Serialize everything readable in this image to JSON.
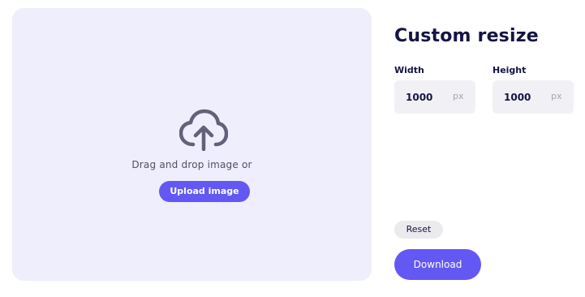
{
  "dropzone": {
    "icon": "cloud-upload-icon",
    "text": "Drag and drop image or",
    "upload_label": "Upload image"
  },
  "panel": {
    "title": "Custom resize",
    "width": {
      "label": "Width",
      "value": "1000",
      "unit": "px"
    },
    "height": {
      "label": "Height",
      "value": "1000",
      "unit": "px"
    },
    "reset_label": "Reset",
    "download_label": "Download"
  },
  "colors": {
    "accent": "#6458f4",
    "dropzone_bg": "#eeeefd",
    "title": "#141446",
    "field_bg": "#f1f1f5"
  }
}
